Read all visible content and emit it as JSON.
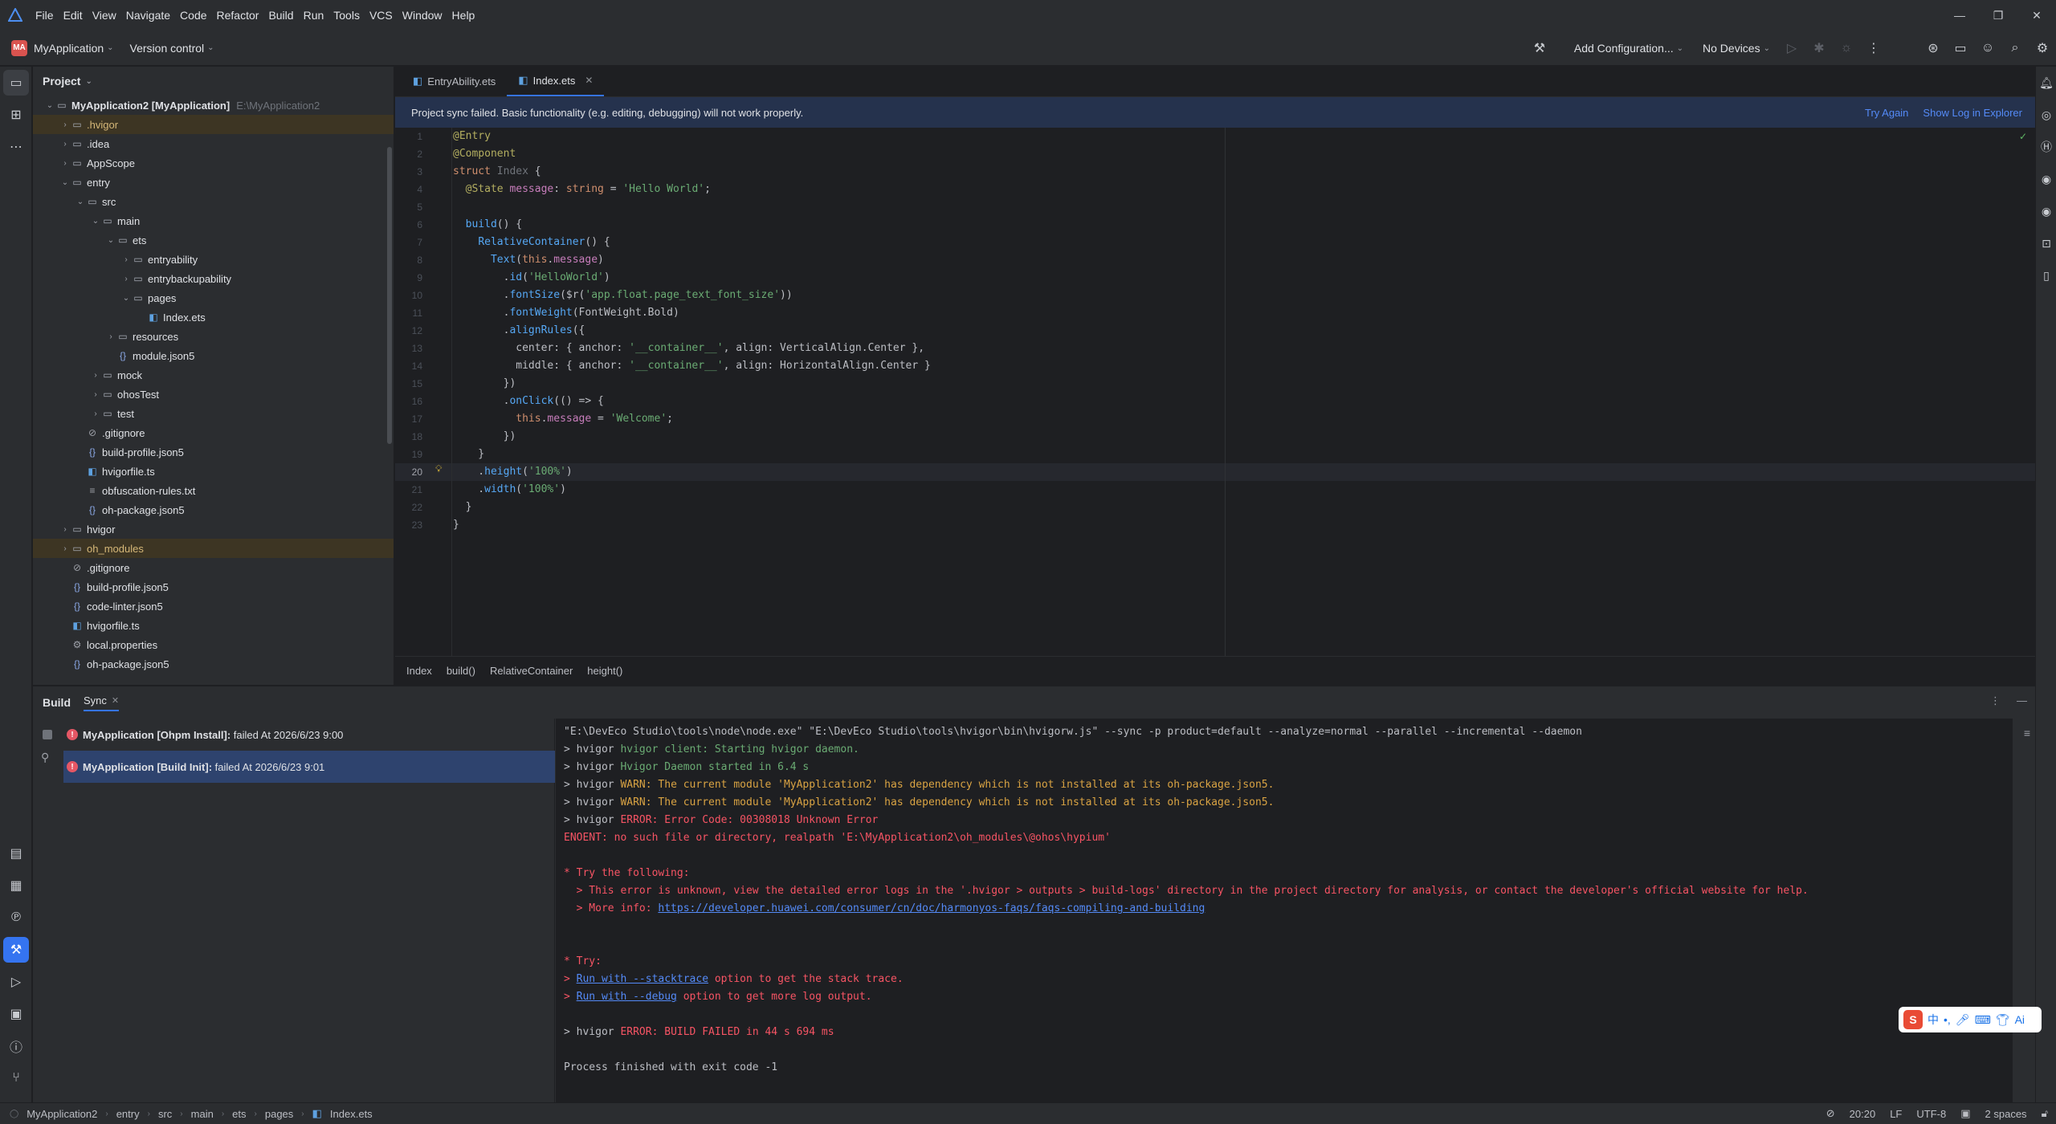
{
  "menu": {
    "items": [
      "File",
      "Edit",
      "View",
      "Navigate",
      "Code",
      "Refactor",
      "Build",
      "Run",
      "Tools",
      "VCS",
      "Window",
      "Help"
    ]
  },
  "toolbar": {
    "project_badge": "MA",
    "project_name": "MyApplication",
    "version_control": "Version control",
    "add_config": "Add Configuration...",
    "devices": "No Devices"
  },
  "project": {
    "title": "Project",
    "root_name": "MyApplication2",
    "root_module": "[MyApplication]",
    "root_path": "E:\\MyApplication2",
    "items": [
      {
        "label": ".hvigor",
        "depth": 1,
        "type": "folder",
        "arrow": "right",
        "hl": true
      },
      {
        "label": ".idea",
        "depth": 1,
        "type": "folder",
        "arrow": "right"
      },
      {
        "label": "AppScope",
        "depth": 1,
        "type": "folder",
        "arrow": "right"
      },
      {
        "label": "entry",
        "depth": 1,
        "type": "folder",
        "arrow": "down"
      },
      {
        "label": "src",
        "depth": 2,
        "type": "folder",
        "arrow": "down"
      },
      {
        "label": "main",
        "depth": 3,
        "type": "folder",
        "arrow": "down"
      },
      {
        "label": "ets",
        "depth": 4,
        "type": "folder",
        "arrow": "down"
      },
      {
        "label": "entryability",
        "depth": 5,
        "type": "folder",
        "arrow": "right"
      },
      {
        "label": "entrybackupability",
        "depth": 5,
        "type": "folder",
        "arrow": "right"
      },
      {
        "label": "pages",
        "depth": 5,
        "type": "folder",
        "arrow": "down"
      },
      {
        "label": "Index.ets",
        "depth": 6,
        "type": "ets",
        "arrow": ""
      },
      {
        "label": "resources",
        "depth": 4,
        "type": "folder",
        "arrow": "right"
      },
      {
        "label": "module.json5",
        "depth": 4,
        "type": "json",
        "arrow": ""
      },
      {
        "label": "mock",
        "depth": 3,
        "type": "folder",
        "arrow": "right"
      },
      {
        "label": "ohosTest",
        "depth": 3,
        "type": "folder",
        "arrow": "right"
      },
      {
        "label": "test",
        "depth": 3,
        "type": "folder",
        "arrow": "right"
      },
      {
        "label": ".gitignore",
        "depth": 2,
        "type": "ignore",
        "arrow": ""
      },
      {
        "label": "build-profile.json5",
        "depth": 2,
        "type": "json",
        "arrow": ""
      },
      {
        "label": "hvigorfile.ts",
        "depth": 2,
        "type": "ts",
        "arrow": ""
      },
      {
        "label": "obfuscation-rules.txt",
        "depth": 2,
        "type": "txt",
        "arrow": ""
      },
      {
        "label": "oh-package.json5",
        "depth": 2,
        "type": "json",
        "arrow": ""
      },
      {
        "label": "hvigor",
        "depth": 1,
        "type": "folder",
        "arrow": "right"
      },
      {
        "label": "oh_modules",
        "depth": 1,
        "type": "folder",
        "arrow": "right",
        "hl": true
      },
      {
        "label": ".gitignore",
        "depth": 1,
        "type": "ignore",
        "arrow": ""
      },
      {
        "label": "build-profile.json5",
        "depth": 1,
        "type": "json",
        "arrow": ""
      },
      {
        "label": "code-linter.json5",
        "depth": 1,
        "type": "json",
        "arrow": ""
      },
      {
        "label": "hvigorfile.ts",
        "depth": 1,
        "type": "ts",
        "arrow": ""
      },
      {
        "label": "local.properties",
        "depth": 1,
        "type": "props",
        "arrow": ""
      },
      {
        "label": "oh-package.json5",
        "depth": 1,
        "type": "json",
        "arrow": ""
      }
    ]
  },
  "editor": {
    "tabs": [
      {
        "label": "EntryAbility.ets",
        "active": false
      },
      {
        "label": "Index.ets",
        "active": true
      }
    ],
    "banner_text": "Project sync failed. Basic functionality (e.g. editing, debugging) will not work properly.",
    "banner_try_again": "Try Again",
    "banner_show_log": "Show Log in Explorer",
    "current_line": 20,
    "lines": [
      "@Entry",
      "@Component",
      "struct Index {",
      "  @State message: string = 'Hello World';",
      "",
      "  build() {",
      "    RelativeContainer() {",
      "      Text(this.message)",
      "        .id('HelloWorld')",
      "        .fontSize($r('app.float.page_text_font_size'))",
      "        .fontWeight(FontWeight.Bold)",
      "        .alignRules({",
      "          center: { anchor: '__container__', align: VerticalAlign.Center },",
      "          middle: { anchor: '__container__', align: HorizontalAlign.Center }",
      "        })",
      "        .onClick(() => {",
      "          this.message = 'Welcome';",
      "        })",
      "    }",
      "    .height('100%')",
      "    .width('100%')",
      "  }",
      "}"
    ],
    "breadcrumbs": [
      "Index",
      "build()",
      "RelativeContainer",
      "height()"
    ]
  },
  "build": {
    "title": "Build",
    "tab": "Sync",
    "tasks": [
      {
        "name": "MyApplication [Ohpm Install]:",
        "status": " failed At 2026/6/23 9:00",
        "selected": false
      },
      {
        "name": "MyApplication [Build Init]:",
        "status": " failed At 2026/6/23 9:01",
        "selected": true
      }
    ],
    "console": [
      {
        "text": "\"E:\\DevEco Studio\\tools\\node\\node.exe\" \"E:\\DevEco Studio\\tools\\hvigor\\bin\\hvigorw.js\" --sync -p product=default --analyze=normal --parallel --incremental --daemon",
        "cls": ""
      },
      {
        "prefix": "> hvigor ",
        "text": "hvigor client: Starting hvigor daemon.",
        "cls": "green"
      },
      {
        "prefix": "> hvigor ",
        "text": "Hvigor Daemon started in 6.4 s",
        "cls": "green"
      },
      {
        "prefix": "> hvigor ",
        "text": "WARN: The current module 'MyApplication2' has dependency which is not installed at its oh-package.json5.",
        "cls": "warn"
      },
      {
        "prefix": "> hvigor ",
        "text": "WARN: The current module 'MyApplication2' has dependency which is not installed at its oh-package.json5.",
        "cls": "warn"
      },
      {
        "prefix": "> hvigor ",
        "text": "ERROR: Error Code: 00308018 Unknown Error",
        "cls": "error"
      },
      {
        "text": "ENOENT: no such file or directory, realpath 'E:\\MyApplication2\\oh_modules\\@ohos\\hypium'",
        "cls": "error"
      },
      {
        "text": "",
        "cls": ""
      },
      {
        "text": "* Try the following:",
        "cls": "error"
      },
      {
        "text": "  > This error is unknown, view the detailed error logs in the '.hvigor > outputs > build-logs' directory in the project directory for analysis, or contact the developer's official website for help.",
        "cls": "error"
      },
      {
        "prefix": "  > More info: ",
        "link": "https://developer.huawei.com/consumer/cn/doc/harmonyos-faqs/faqs-compiling-and-building",
        "cls": "error"
      },
      {
        "text": "",
        "cls": ""
      },
      {
        "text": "",
        "cls": ""
      },
      {
        "text": "* Try:",
        "cls": "error"
      },
      {
        "prefix": "> ",
        "link": "Run with --stacktrace",
        "suffix": " option to get the stack trace.",
        "cls": "error"
      },
      {
        "prefix": "> ",
        "link": "Run with --debug",
        "suffix": " option to get more log output.",
        "cls": "error"
      },
      {
        "text": "",
        "cls": ""
      },
      {
        "prefix": "> hvigor ",
        "text": "ERROR: BUILD FAILED in 44 s 694 ms",
        "cls": "error"
      },
      {
        "text": "",
        "cls": ""
      },
      {
        "text": "Process finished with exit code -1",
        "cls": ""
      }
    ]
  },
  "status": {
    "path": [
      "MyApplication2",
      "entry",
      "src",
      "main",
      "ets",
      "pages",
      "Index.ets"
    ],
    "position": "20:20",
    "line_sep": "LF",
    "encoding": "UTF-8",
    "indent": "2 spaces"
  },
  "ime": {
    "lang": "中",
    "ai": "Ai"
  }
}
